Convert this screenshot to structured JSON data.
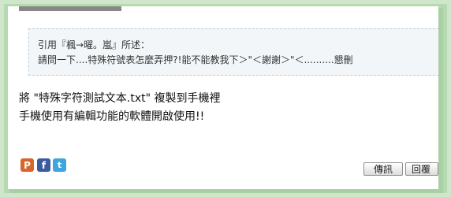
{
  "quote": {
    "header": "引用『楓→曜。嵐』所述：",
    "body": "請問一下....特殊符號表怎麼弄押?!能不能教我下＞\"＜謝謝＞\"＜..........懇刪"
  },
  "message": {
    "line1": "將 \"特殊字符測試文本.txt\" 複製到手機裡",
    "line2": "手機使用有編輯功能的軟體開啟使用!!"
  },
  "share_icons": [
    {
      "name": "plurk-icon",
      "glyph": "P"
    },
    {
      "name": "facebook-icon",
      "glyph": "f"
    },
    {
      "name": "twitter-icon",
      "glyph": "t"
    }
  ],
  "buttons": {
    "message_label": "傳訊",
    "reply_label": "回覆"
  }
}
